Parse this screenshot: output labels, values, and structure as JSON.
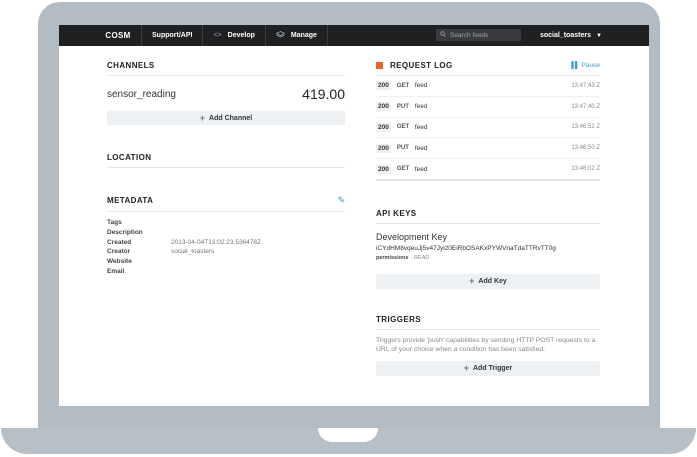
{
  "app": {
    "logo": "COSM",
    "nav": [
      {
        "label": "Support/API",
        "icon": ""
      },
      {
        "label": "Develop",
        "icon": "<>"
      },
      {
        "label": "Manage",
        "icon": "layers"
      }
    ],
    "search_placeholder": "Search feeds",
    "user": "social_toasters"
  },
  "channels": {
    "title": "CHANNELS",
    "items": [
      {
        "name": "sensor_reading",
        "value": "419.00"
      }
    ],
    "add_label": "Add Channel"
  },
  "location": {
    "title": "LOCATION"
  },
  "metadata": {
    "title": "METADATA",
    "rows": [
      {
        "key": "Tags",
        "value": ""
      },
      {
        "key": "Description",
        "value": ""
      },
      {
        "key": "Created",
        "value": "2013-04-04T13:02:23.536478Z"
      },
      {
        "key": "Creator",
        "value": "social_toasters"
      },
      {
        "key": "Website",
        "value": ""
      },
      {
        "key": "Email",
        "value": ""
      }
    ]
  },
  "request_log": {
    "title": "REQUEST LOG",
    "pause_label": "Pause",
    "accent_color": "#e8632c",
    "entries": [
      {
        "status": "200",
        "method": "GET",
        "path": "feed",
        "time": "13:47:43 Z"
      },
      {
        "status": "200",
        "method": "PUT",
        "path": "feed",
        "time": "13:47:40 Z"
      },
      {
        "status": "200",
        "method": "GET",
        "path": "feed",
        "time": "13:46:52 Z"
      },
      {
        "status": "200",
        "method": "PUT",
        "path": "feed",
        "time": "13:46:50 Z"
      },
      {
        "status": "200",
        "method": "GET",
        "path": "feed",
        "time": "13:46:02 Z"
      }
    ]
  },
  "api_keys": {
    "title": "API KEYS",
    "key_name": "Development Key",
    "key_value": "iCYdHM8vqeuJj5v47Jyi20EiRbOSAKxPYWVnaTdaTTRvTT0g",
    "permissions_label": "permissions",
    "permissions_value": "READ",
    "add_label": "Add Key"
  },
  "triggers": {
    "title": "TRIGGERS",
    "description": "Triggers provide 'push' capabilities by sending HTTP POST requests to a URL of your choice when a condition has been satisfied.",
    "add_label": "Add Trigger"
  }
}
